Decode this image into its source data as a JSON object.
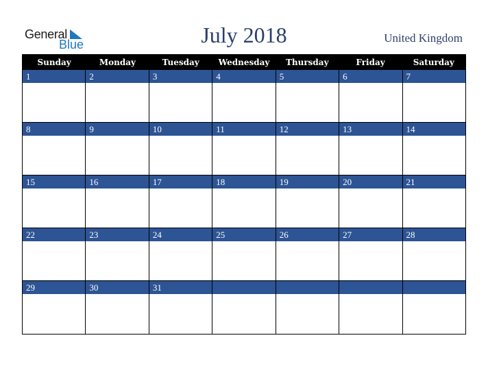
{
  "logo": {
    "general": "General",
    "blue": "Blue"
  },
  "title": "July 2018",
  "country": "United Kingdom",
  "colors": {
    "band": "#2d5494",
    "header": "#000000",
    "title": "#2b3f6b"
  },
  "weekdays": [
    "Sunday",
    "Monday",
    "Tuesday",
    "Wednesday",
    "Thursday",
    "Friday",
    "Saturday"
  ],
  "weeks": [
    [
      "1",
      "2",
      "3",
      "4",
      "5",
      "6",
      "7"
    ],
    [
      "8",
      "9",
      "10",
      "11",
      "12",
      "13",
      "14"
    ],
    [
      "15",
      "16",
      "17",
      "18",
      "19",
      "20",
      "21"
    ],
    [
      "22",
      "23",
      "24",
      "25",
      "26",
      "27",
      "28"
    ],
    [
      "29",
      "30",
      "31",
      "",
      "",
      "",
      ""
    ]
  ]
}
